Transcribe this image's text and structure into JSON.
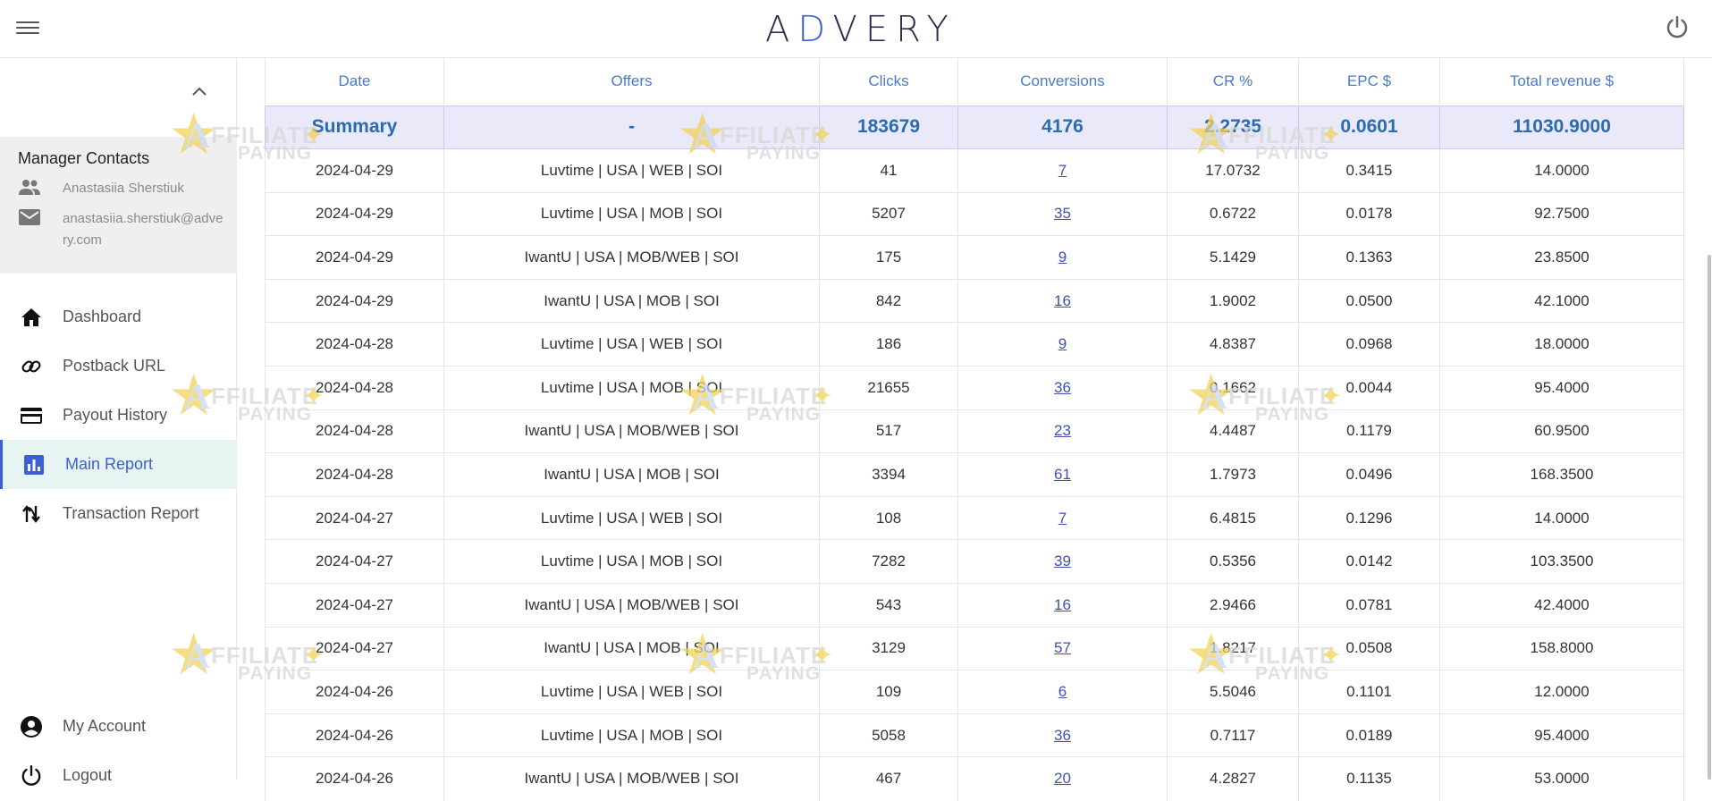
{
  "header": {
    "logo_prefix": "A",
    "logo_accent": "D",
    "logo_rest": "VERY",
    "menu_icon": "hamburger-menu-icon",
    "power_icon": "power-icon"
  },
  "sidebar": {
    "collapse_icon": "chevron-up-icon",
    "contacts": {
      "title": "Manager Contacts",
      "name": "Anastasiia Sherstiuk",
      "email": "anastasiia.sherstiuk@advery.com"
    },
    "nav": [
      {
        "label": "Dashboard",
        "icon": "home-icon"
      },
      {
        "label": "Postback URL",
        "icon": "link-icon"
      },
      {
        "label": "Payout History",
        "icon": "credit-card-icon"
      },
      {
        "label": "Main Report",
        "icon": "bar-chart-icon",
        "active": true
      },
      {
        "label": "Transaction Report",
        "icon": "transaction-icon"
      }
    ],
    "bottom": [
      {
        "label": "My Account",
        "icon": "account-circle-icon"
      },
      {
        "label": "Logout",
        "icon": "power-icon"
      }
    ]
  },
  "table": {
    "headers": [
      "Date",
      "Offers",
      "Clicks",
      "Conversions",
      "CR %",
      "EPC $",
      "Total revenue $"
    ],
    "summary": [
      "Summary",
      "-",
      "183679",
      "4176",
      "2.2735",
      "0.0601",
      "11030.9000"
    ],
    "rows": [
      [
        "2024-04-29",
        "Luvtime | USA | WEB | SOI",
        "41",
        "7",
        "17.0732",
        "0.3415",
        "14.0000"
      ],
      [
        "2024-04-29",
        "Luvtime | USA | MOB | SOI",
        "5207",
        "35",
        "0.6722",
        "0.0178",
        "92.7500"
      ],
      [
        "2024-04-29",
        "IwantU | USA | MOB/WEB | SOI",
        "175",
        "9",
        "5.1429",
        "0.1363",
        "23.8500"
      ],
      [
        "2024-04-29",
        "IwantU | USA | MOB | SOI",
        "842",
        "16",
        "1.9002",
        "0.0500",
        "42.1000"
      ],
      [
        "2024-04-28",
        "Luvtime | USA | WEB | SOI",
        "186",
        "9",
        "4.8387",
        "0.0968",
        "18.0000"
      ],
      [
        "2024-04-28",
        "Luvtime | USA | MOB | SOI",
        "21655",
        "36",
        "0.1662",
        "0.0044",
        "95.4000"
      ],
      [
        "2024-04-28",
        "IwantU | USA | MOB/WEB | SOI",
        "517",
        "23",
        "4.4487",
        "0.1179",
        "60.9500"
      ],
      [
        "2024-04-28",
        "IwantU | USA | MOB | SOI",
        "3394",
        "61",
        "1.7973",
        "0.0496",
        "168.3500"
      ],
      [
        "2024-04-27",
        "Luvtime | USA | WEB | SOI",
        "108",
        "7",
        "6.4815",
        "0.1296",
        "14.0000"
      ],
      [
        "2024-04-27",
        "Luvtime | USA | MOB | SOI",
        "7282",
        "39",
        "0.5356",
        "0.0142",
        "103.3500"
      ],
      [
        "2024-04-27",
        "IwantU | USA | MOB/WEB | SOI",
        "543",
        "16",
        "2.9466",
        "0.0781",
        "42.4000"
      ],
      [
        "2024-04-27",
        "IwantU | USA | MOB | SOI",
        "3129",
        "57",
        "1.8217",
        "0.0508",
        "158.8000"
      ],
      [
        "2024-04-26",
        "Luvtime | USA | WEB | SOI",
        "109",
        "6",
        "5.5046",
        "0.1101",
        "12.0000"
      ],
      [
        "2024-04-26",
        "Luvtime | USA | MOB | SOI",
        "5058",
        "36",
        "0.7117",
        "0.0189",
        "95.4000"
      ],
      [
        "2024-04-26",
        "IwantU | USA | MOB/WEB | SOI",
        "467",
        "20",
        "4.2827",
        "0.1135",
        "53.0000"
      ]
    ]
  },
  "watermark": {
    "icon": "affiliate-paying-watermark-icon",
    "letter": "A",
    "line1": "FFILIATE",
    "line2": "PAYING"
  }
}
